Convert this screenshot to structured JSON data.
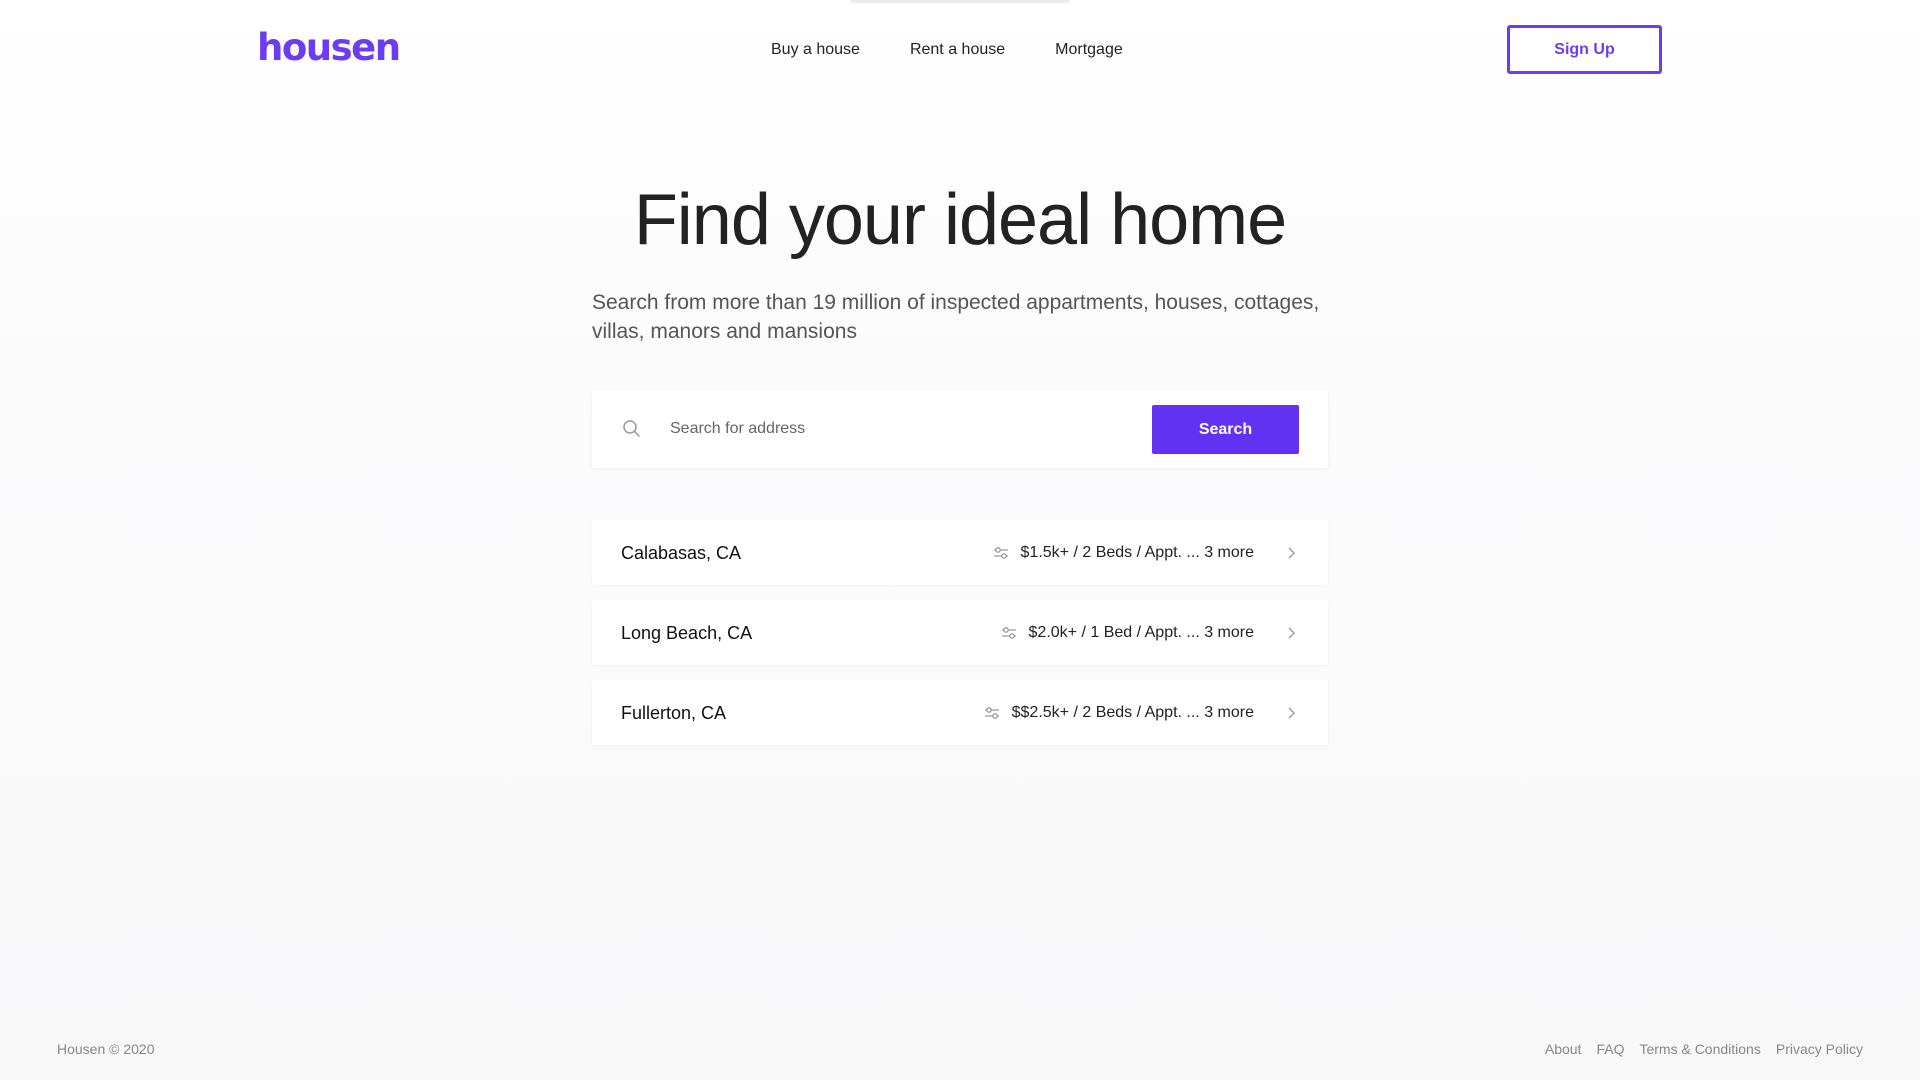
{
  "brand": {
    "logo": "housen",
    "accent_color": "#6c3cf4",
    "button_color": "#6132f2"
  },
  "nav": {
    "items": [
      {
        "label": "Buy a house"
      },
      {
        "label": "Rent a house"
      },
      {
        "label": "Mortgage"
      }
    ],
    "signup_label": "Sign Up"
  },
  "hero": {
    "title": "Find your ideal home",
    "subtitle": "Search from more than 19 million of inspected appartments, houses, cottages, villas, manors and mansions"
  },
  "search": {
    "icon": "search-icon",
    "placeholder": "Search for address",
    "value": "",
    "button_label": "Search"
  },
  "saved_searches": [
    {
      "city": "Calabasas, CA",
      "summary": "$1.5k+ / 2 Beds / Appt. ... 3 more",
      "icon": "filter-icon"
    },
    {
      "city": "Long Beach, CA",
      "summary": "$2.0k+ / 1 Bed / Appt. ... 3 more",
      "icon": "filter-icon"
    },
    {
      "city": "Fullerton, CA",
      "summary": "$$2.5k+ / 2 Beds / Appt. ... 3 more",
      "icon": "filter-icon"
    }
  ],
  "footer": {
    "copyright": "Housen © 2020",
    "links": [
      {
        "label": "About"
      },
      {
        "label": "FAQ"
      },
      {
        "label": "Terms & Conditions"
      },
      {
        "label": "Privacy Policy"
      }
    ]
  }
}
